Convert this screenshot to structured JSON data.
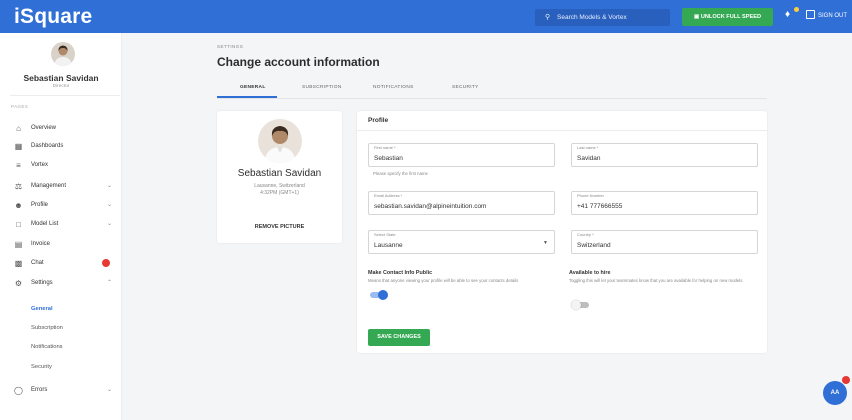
{
  "brand": {
    "logo": "iSquare",
    "accent": "#2f6fd6",
    "success": "#34a853",
    "danger": "#e53935"
  },
  "topbar": {
    "search_placeholder": "Search Models & Vortex",
    "unlock_label": "UNLOCK FULL SPEED",
    "signout_label": "SIGN OUT",
    "icons": [
      "search-icon",
      "lock-icon",
      "bell-icon",
      "signout-icon"
    ]
  },
  "sidebar": {
    "user_name": "Sebastian Savidan",
    "user_role": "Director",
    "section_label": "PAGES",
    "items": [
      {
        "label": "Overview",
        "icon": "home-icon"
      },
      {
        "label": "Dashboards",
        "icon": "dashboard-icon"
      },
      {
        "label": "Vortex",
        "icon": "list-icon"
      },
      {
        "label": "Management",
        "icon": "management-icon",
        "expandable": true
      },
      {
        "label": "Profile",
        "icon": "user-icon",
        "expandable": true
      },
      {
        "label": "Model List",
        "icon": "folder-icon",
        "expandable": true
      },
      {
        "label": "Invoice",
        "icon": "invoice-icon"
      },
      {
        "label": "Chat",
        "icon": "chat-icon",
        "badge": true
      },
      {
        "label": "Settings",
        "icon": "gear-icon",
        "expandable": true,
        "expanded": true
      },
      {
        "label": "Errors",
        "icon": "error-icon",
        "expandable": true
      }
    ],
    "settings_sub": [
      "General",
      "Subscription",
      "Notifications",
      "Security"
    ],
    "active_sub": "General"
  },
  "header": {
    "breadcrumb": "SETTINGS",
    "title": "Change account information",
    "tabs": [
      "GENERAL",
      "SUBSCRIPTION",
      "NOTIFICATIONS",
      "SECURITY"
    ],
    "active_tab": "GENERAL"
  },
  "profile_card": {
    "name": "Sebastian Savidan",
    "location": "Lausanne, Switzerland",
    "timezone": "4:32PM (GMT+1)",
    "remove_label": "REMOVE PICTURE"
  },
  "form": {
    "title": "Profile",
    "first_name": {
      "label": "First name *",
      "value": "Sebastian",
      "hint": "Please specify the first name"
    },
    "last_name": {
      "label": "Last name *",
      "value": "Savidan"
    },
    "email": {
      "label": "Email Address *",
      "value": "sebastian.savidan@alpineintuition.com"
    },
    "phone": {
      "label": "Phone Number",
      "value": "+41 777666555"
    },
    "state": {
      "label": "Select State",
      "value": "Lausanne"
    },
    "country": {
      "label": "Country *",
      "value": "Switzerland"
    },
    "contact_public": {
      "title": "Make Contact Info Public",
      "description": "Means that anyone viewing your profile will be able to see your contacts details",
      "on": true
    },
    "available": {
      "title": "Available to hire",
      "description": "Toggling this will let your teammates know that you are available for helping on new models",
      "on": false
    },
    "save_label": "SAVE CHANGES"
  },
  "fab": {
    "label": "AA"
  }
}
